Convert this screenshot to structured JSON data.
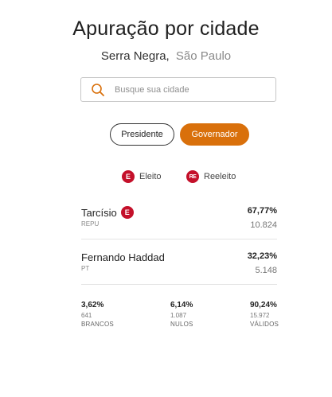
{
  "header": {
    "title": "Apuração por cidade",
    "city": "Serra Negra,",
    "state": "São Paulo"
  },
  "search": {
    "placeholder": "Busque sua cidade",
    "icon": "search-icon",
    "icon_color": "#d9700b"
  },
  "tabs": [
    {
      "label": "Presidente",
      "active": false
    },
    {
      "label": "Governador",
      "active": true
    }
  ],
  "legend": [
    {
      "badge": "E",
      "label": "Eleito"
    },
    {
      "badge": "RE",
      "label": "Reeleito"
    }
  ],
  "candidates": [
    {
      "name": "Tarcísio",
      "badge": "E",
      "party": "REPU",
      "percent": "67,77%",
      "votes": "10.824"
    },
    {
      "name": "Fernando Haddad",
      "badge": "",
      "party": "PT",
      "percent": "32,23%",
      "votes": "5.148"
    }
  ],
  "summary": [
    {
      "percent": "3,62%",
      "count": "641",
      "label": "BRANCOS"
    },
    {
      "percent": "6,14%",
      "count": "1.087",
      "label": "NULOS"
    },
    {
      "percent": "90,24%",
      "count": "15.972",
      "label": "VÁLIDOS"
    }
  ],
  "colors": {
    "accent": "#d9700b",
    "badge": "#c4102a"
  }
}
